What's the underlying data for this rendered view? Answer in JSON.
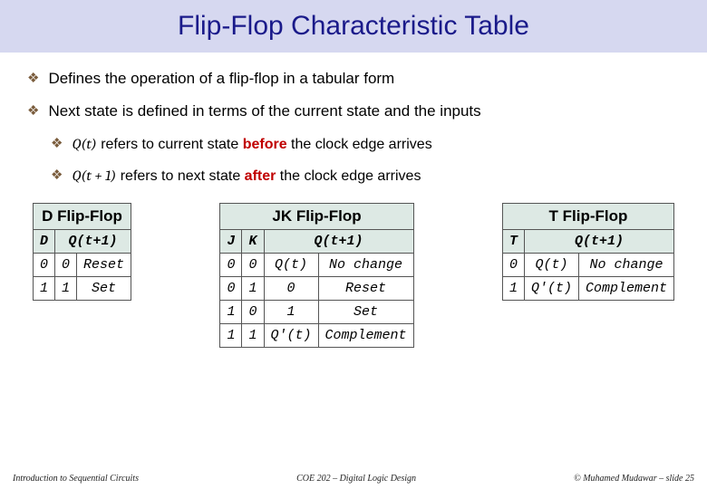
{
  "title": "Flip-Flop Characteristic Table",
  "bullets": {
    "b1": "Defines the operation of a flip-flop in a tabular form",
    "b2": "Next state is defined in terms of the current state and the inputs",
    "s1a": "Q(t)",
    "s1b": " refers to current state ",
    "s1c": "before",
    "s1d": " the clock edge arrives",
    "s2a": "Q(t + 1)",
    "s2b": " refers to next state ",
    "s2c": "after",
    "s2d": " the clock edge arrives"
  },
  "tables": {
    "d": {
      "title": "D Flip-Flop",
      "h1": "D",
      "h2": "Q(t+1)",
      "r1c1": "0",
      "r1c2": "0",
      "r1c3": "Reset",
      "r2c1": "1",
      "r2c2": "1",
      "r2c3": "Set"
    },
    "jk": {
      "title": "JK Flip-Flop",
      "h1": "J",
      "h2": "K",
      "h3": "Q(t+1)",
      "r1c1": "0",
      "r1c2": "0",
      "r1c3": "Q(t)",
      "r1c4": "No change",
      "r2c1": "0",
      "r2c2": "1",
      "r2c3": "0",
      "r2c4": "Reset",
      "r3c1": "1",
      "r3c2": "0",
      "r3c3": "1",
      "r3c4": "Set",
      "r4c1": "1",
      "r4c2": "1",
      "r4c3": "Q'(t)",
      "r4c4": "Complement"
    },
    "t": {
      "title": "T Flip-Flop",
      "h1": "T",
      "h2": "Q(t+1)",
      "r1c1": "0",
      "r1c2": "Q(t)",
      "r1c3": "No change",
      "r2c1": "1",
      "r2c2": "Q'(t)",
      "r2c3": "Complement"
    }
  },
  "footer": {
    "left": "Introduction to Sequential Circuits",
    "center": "COE 202 – Digital Logic Design",
    "right": "© Muhamed Mudawar – slide 25"
  }
}
